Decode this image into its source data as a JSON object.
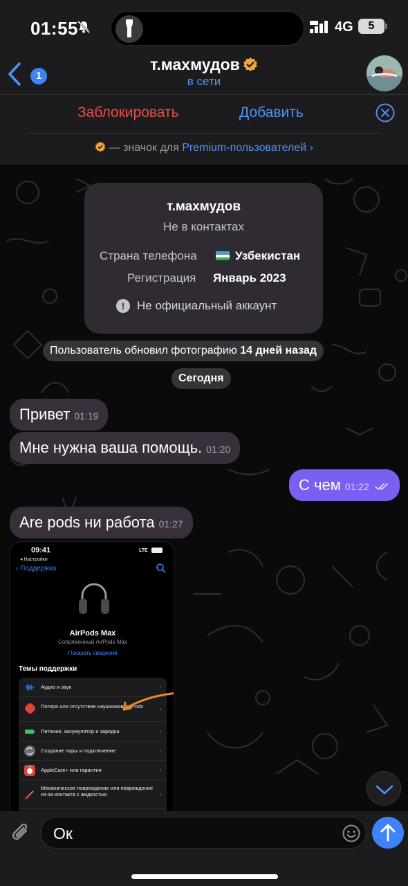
{
  "status": {
    "time": "01:55",
    "network": "4G",
    "battery": "5"
  },
  "header": {
    "back_count": "1",
    "title": "т.махмудов",
    "status": "в сети"
  },
  "actions": {
    "block": "Заблокировать",
    "add": "Добавить"
  },
  "premium": {
    "text": " — значок для ",
    "link": "Premium-пользователей",
    "chevron": "›"
  },
  "info_card": {
    "name": "т.махмудов",
    "subtitle": "Не в контактах",
    "country_label": "Страна телефона",
    "country_value": "Узбекистан",
    "reg_label": "Регистрация",
    "reg_value": "Январь 2023",
    "warning": "Не официальный аккаунт"
  },
  "service": {
    "photo_prefix": "Пользователь обновил фотографию",
    "photo_when": "14 дней назад",
    "date": "Сегодня"
  },
  "messages": [
    {
      "text": "Привет",
      "time": "01:19",
      "dir": "in"
    },
    {
      "text": "Мне нужна ваша помощь.",
      "time": "01:20",
      "dir": "in"
    },
    {
      "text": "С чем",
      "time": "01:22",
      "dir": "out"
    },
    {
      "text": "Are pods ни работа",
      "time": "01:27",
      "dir": "in"
    }
  ],
  "screenshot": {
    "time": "09:41",
    "back_app": "◂ Настройки",
    "network": "LTE",
    "nav_back": "‹ Поддержка",
    "device": "AirPods Max",
    "paired": "Сопряженный AirPods Max",
    "details": "Показать сведения",
    "topics_title": "Темы поддержки",
    "topics": [
      {
        "label": "Аудио и звук",
        "icon": "audio-wave-icon",
        "color": "#1c1c1e"
      },
      {
        "label": "Потеря или отсутствие наушников AirPods",
        "icon": "warning-diamond-icon",
        "color": "#e0443a"
      },
      {
        "label": "Питание, аккумулятор и зарядка",
        "icon": "battery-icon",
        "color": "#1c1c1e"
      },
      {
        "label": "Создание пары и подключение",
        "icon": "sync-icon",
        "color": "#6e6e73"
      },
      {
        "label": "AppleCare+ или гарантия",
        "icon": "apple-logo-icon",
        "color": "#e0443a"
      },
      {
        "label": "Механическое повреждение или повреждение из-за контакта с жидкостью",
        "icon": "screwdriver-icon",
        "color": "#1c1c1e"
      }
    ]
  },
  "input": {
    "value": "Ок"
  },
  "colors": {
    "accent_blue": "#4f92f6",
    "danger_red": "#eb4d46",
    "outgoing_bubble": "#7b5ff2",
    "incoming_bubble": "#37303b"
  }
}
